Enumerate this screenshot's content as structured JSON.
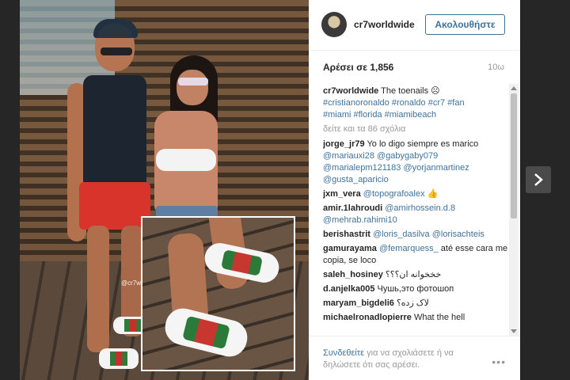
{
  "post": {
    "watermark": "@cr7worldwide"
  },
  "header": {
    "username": "cr7worldwide",
    "follow_label": "Ακολουθήστε"
  },
  "stats": {
    "likes": "Αρέσει σε 1,856",
    "time": "10ω"
  },
  "caption": {
    "user": "cr7worldwide",
    "text": "The toenails ☹",
    "tags_line1": "#cristianoronaldo #ronaldo #cr7 #fan",
    "tags_line2": "#miami #florida #miamibeach",
    "view_all": "δείτε και τα 86 σχόλια"
  },
  "comments": [
    {
      "user": "jorge_jr79",
      "text": "Yo lo digo siempre es marico",
      "tags": "@mariauxi28 @gabygaby079 @marialepm121183 @yorjanmartinez @gusta_aparicio"
    },
    {
      "user": "jxm_vera",
      "text": "",
      "tags": "@topografoalex 👍"
    },
    {
      "user": "amir.1lahroudi",
      "text": "",
      "tags": "@amirhossein.d.8 @mehrab.rahimi10"
    },
    {
      "user": "berishastrit",
      "text": "",
      "tags": "@loris_dasilva @lorisachteis"
    },
    {
      "user": "gamurayama",
      "text": "até esse cara me copia, se loco",
      "tags": "@femarquess_"
    },
    {
      "user": "saleh_hosiney",
      "text": "خخخوانه ان؟؟؟",
      "tags": ""
    },
    {
      "user": "d.anjelka005",
      "text": "Чушь,это фотошоп",
      "tags": ""
    },
    {
      "user": "maryam_bigdeli6",
      "text": "لاک زده؟",
      "tags": ""
    },
    {
      "user": "michaelronadlopierre",
      "text": "What the hell",
      "tags": ""
    }
  ],
  "footer": {
    "login": "Συνδεθείτε",
    "rest": " για να σχολιάσετε ή να δηλώσετε ότι σας αρέσει.",
    "more": "•••"
  },
  "nav": {
    "next_icon": "chevron-right-icon"
  },
  "colors": {
    "link": "#3f729b",
    "muted": "#999999",
    "text": "#262626",
    "backdrop": "#262626"
  }
}
